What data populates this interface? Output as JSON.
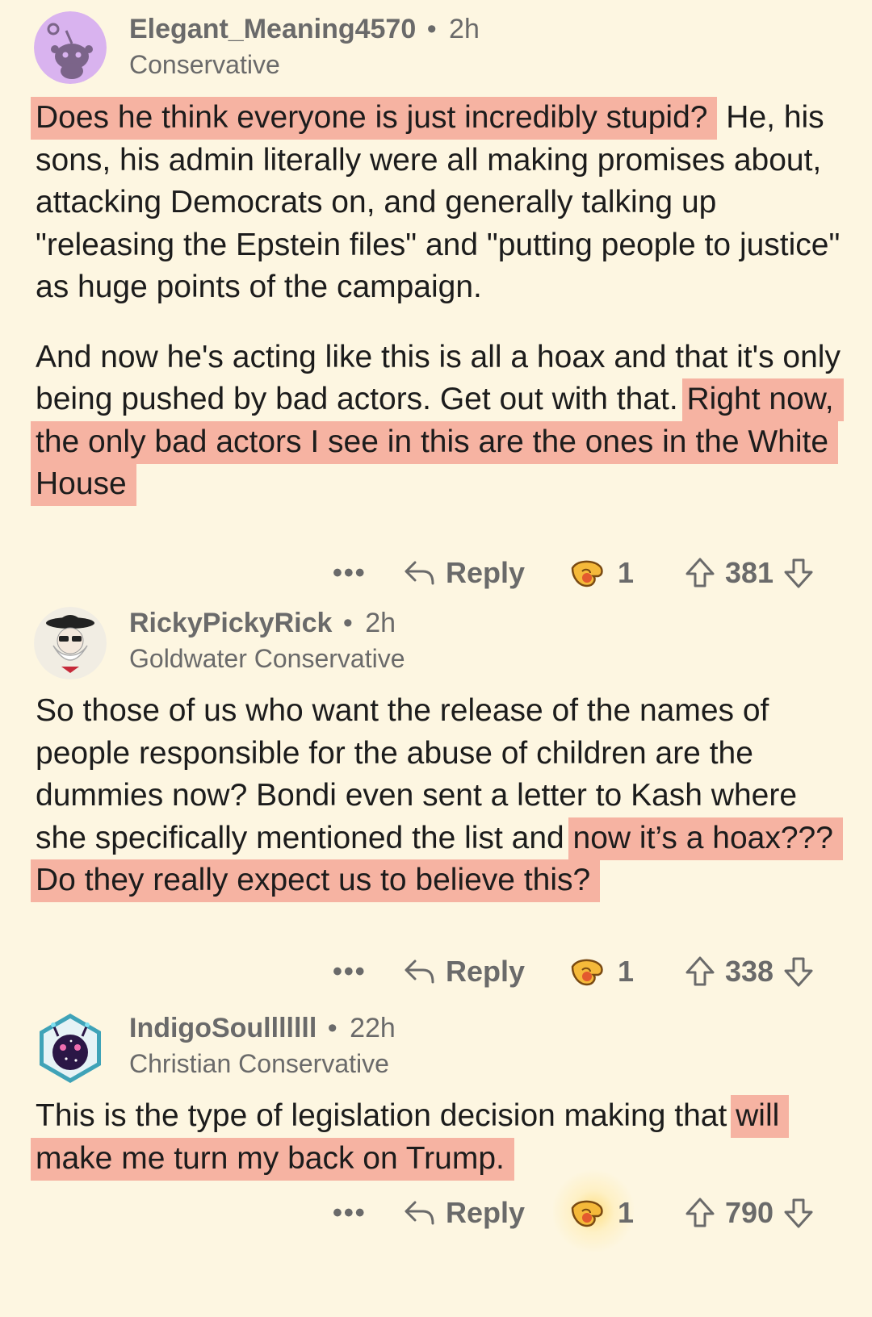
{
  "comments": [
    {
      "username": "Elegant_Meaning4570",
      "age": "2h",
      "flair": "Conservative",
      "avatar_icon": "snoo-default-avatar",
      "paragraphs": [
        [
          {
            "text": "Does he think everyone is just incredibly stupid?",
            "highlight": true
          },
          {
            "text": " He, his sons, his admin literally were all making promises about, attacking Democrats on, and generally talking up \"releasing the Epstein files\" and \"putting people to justice\" as huge points of the campaign.",
            "highlight": false
          }
        ],
        [
          {
            "text": "And now he's acting like this is all a hoax and that it's only being pushed by bad actors. Get out with that. ",
            "highlight": false
          },
          {
            "text": "Right now, the only bad actors I see in this are the ones in the White House",
            "highlight": true
          }
        ]
      ],
      "actions": {
        "more": "•••",
        "reply": "Reply",
        "award_count": "1",
        "votes": "381"
      }
    },
    {
      "username": "RickyPickyRick",
      "age": "2h",
      "flair": "Goldwater Conservative",
      "avatar_icon": "santa-sunglasses-avatar",
      "paragraphs": [
        [
          {
            "text": "So those of us who want the release of the names of people responsible for the abuse of children are the dummies now? Bondi even sent a letter to Kash where she specifically mentioned the list and ",
            "highlight": false
          },
          {
            "text": "now it’s a hoax??? Do they really expect us to believe this?",
            "highlight": true
          }
        ]
      ],
      "actions": {
        "more": "•••",
        "reply": "Reply",
        "award_count": "1",
        "votes": "338"
      }
    },
    {
      "username": "IndigoSoulllllll",
      "age": "22h",
      "flair": "Christian Conservative",
      "avatar_icon": "galaxy-robot-avatar",
      "paragraphs": [
        [
          {
            "text": "This is the type of legislation decision making that ",
            "highlight": false
          },
          {
            "text": "will make me turn my back on Trump.",
            "highlight": true
          }
        ]
      ],
      "actions": {
        "more": "•••",
        "reply": "Reply",
        "award_count": "1",
        "votes": "790"
      }
    }
  ],
  "colors": {
    "background": "#fdf6e1",
    "highlight": "#f6b3a2",
    "meta_text": "#6a6a6a",
    "body_text": "#1c1c1c"
  }
}
